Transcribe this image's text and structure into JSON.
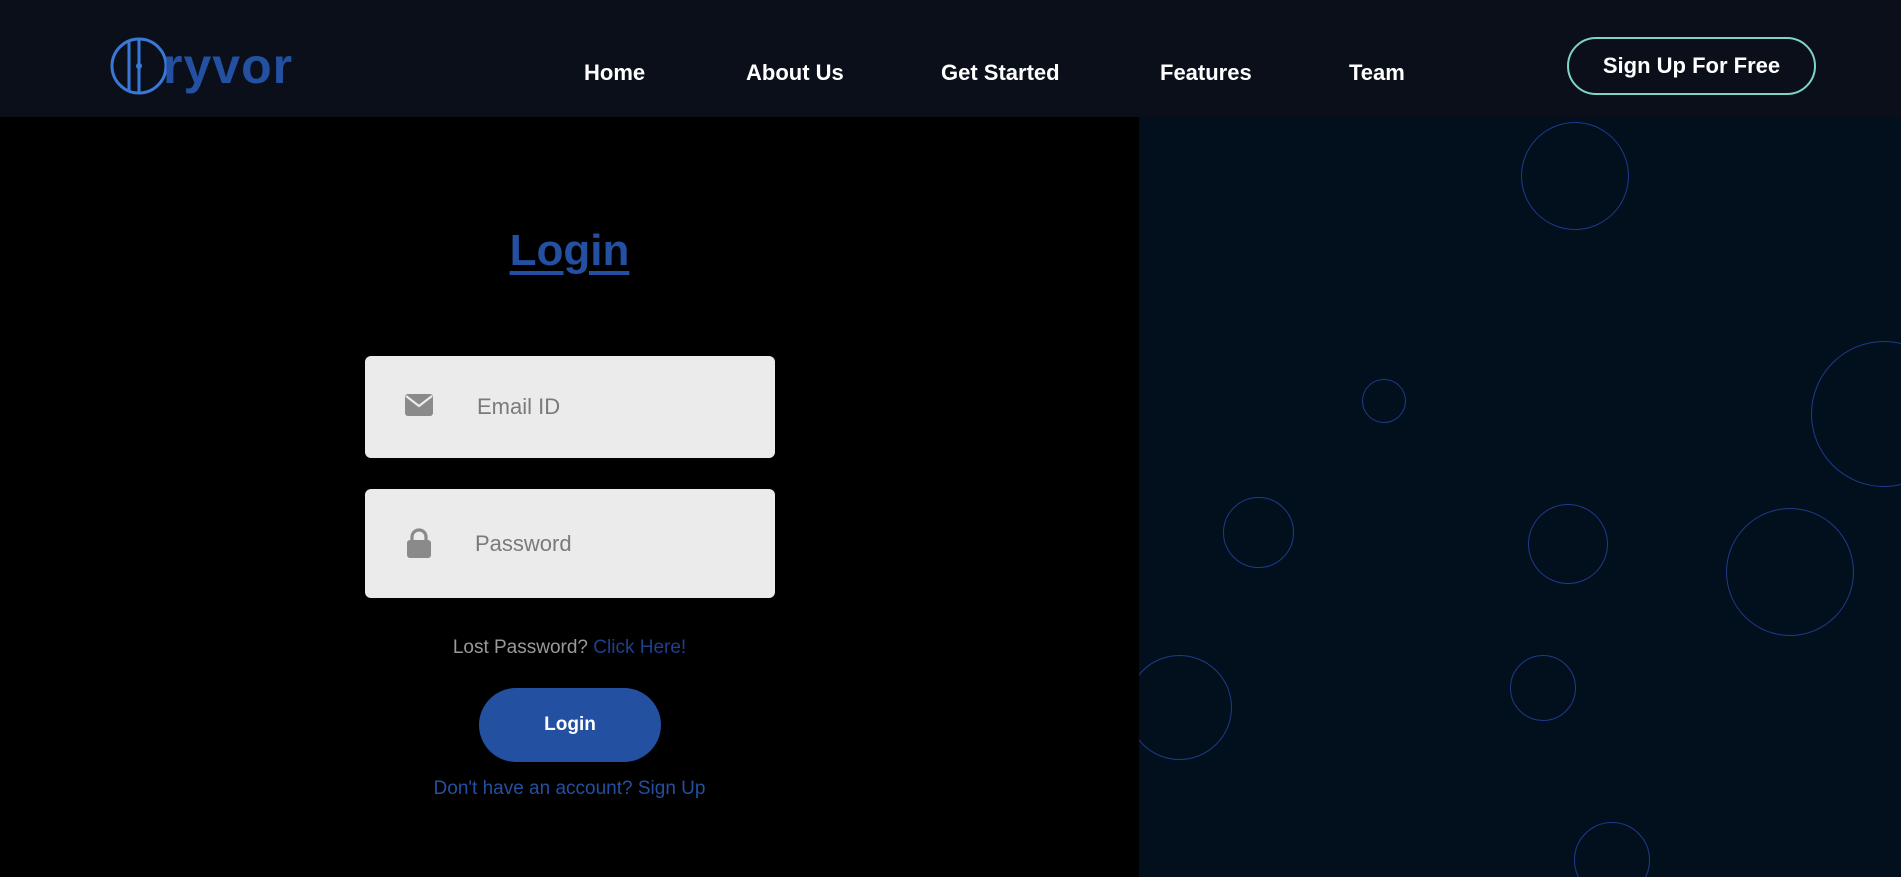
{
  "brand": {
    "logo_text": "ryvor",
    "accent_color": "#2350a0"
  },
  "nav": {
    "items": [
      {
        "label": "Home"
      },
      {
        "label": "About Us"
      },
      {
        "label": "Get Started"
      },
      {
        "label": "Features"
      },
      {
        "label": "Team"
      }
    ],
    "cta_label": "Sign Up For Free"
  },
  "login": {
    "title": "Login",
    "email": {
      "placeholder": "Email ID",
      "value": "",
      "icon": "envelope-icon"
    },
    "password": {
      "placeholder": "Password",
      "value": "",
      "icon": "lock-icon"
    },
    "lost_password_text": "Lost Password?",
    "lost_password_link": "Click Here!",
    "submit_label": "Login",
    "signup_text": "Don't have an account? Sign Up"
  },
  "colors": {
    "navbar_bg": "#0a0f1a",
    "left_bg": "#000000",
    "right_bg": "#02101e",
    "cta_border": "#7fd4c8",
    "field_bg": "#ebebeb",
    "bubble_border": "#1e3a8a"
  }
}
